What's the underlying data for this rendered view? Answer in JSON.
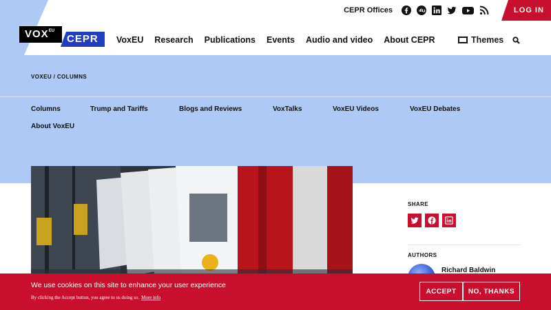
{
  "topbar": {
    "offices": "CEPR Offices",
    "social_icons": [
      "facebook-icon",
      "soundcloud-icon",
      "linkedin-icon",
      "twitter-icon",
      "youtube-icon",
      "rss-icon"
    ],
    "login": "LOG IN"
  },
  "logo": {
    "vox": "VOX",
    "eu": "EU",
    "cepr": "CEPR"
  },
  "nav": {
    "items": [
      "VoxEU",
      "Research",
      "Publications",
      "Events",
      "Audio and video",
      "About CEPR"
    ],
    "themes": "Themes"
  },
  "breadcrumb": "VOXEU / COLUMNS",
  "subnav": [
    "Columns",
    "Trump and Tariffs",
    "Blogs and Reviews",
    "VoxTalks",
    "VoxEU Videos",
    "VoxEU Debates",
    "About VoxEU"
  ],
  "sidebar": {
    "share_label": "SHARE",
    "share_icons": [
      "twitter-icon",
      "facebook-icon",
      "linkedin-icon"
    ],
    "authors_label": "AUTHORS",
    "author": "Richard Baldwin"
  },
  "cookie": {
    "title": "We use cookies on this site to enhance your user experience",
    "text": "By clicking the Accept button, you agree to us doing so.",
    "more": "More info",
    "accept": "ACCEPT",
    "decline": "NO, THANKS"
  },
  "colors": {
    "brand_red": "#c8102e",
    "band_blue": "#aec9f5",
    "cepr_blue": "#1f3fbf"
  }
}
